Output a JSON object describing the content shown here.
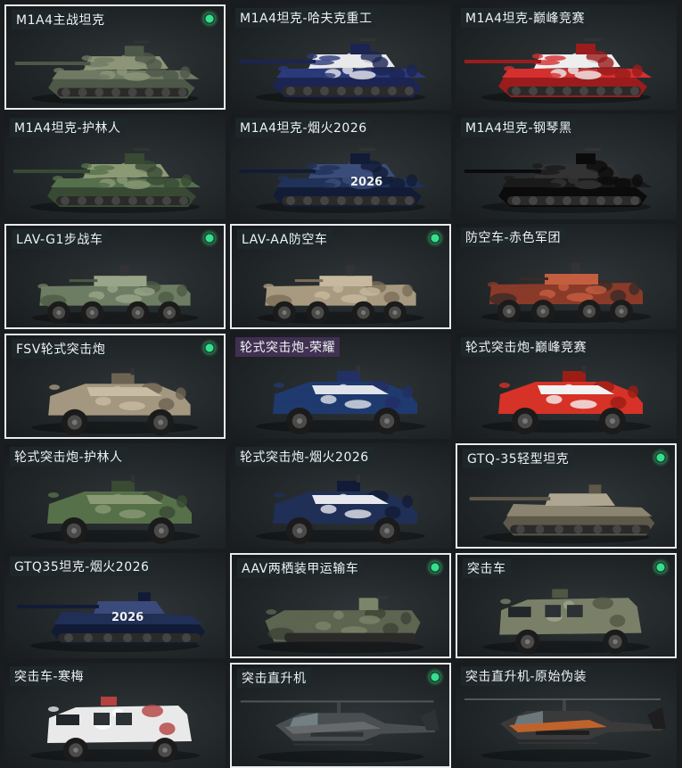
{
  "vehicles": [
    {
      "name": "M1A4主战坦克",
      "owned": true,
      "selected": true,
      "kind": "tank",
      "colors": [
        "#6e7a63",
        "#8d9579",
        "#4d5848"
      ]
    },
    {
      "name": "M1A4坦克-哈夫克重工",
      "owned": false,
      "selected": false,
      "kind": "tank",
      "colors": [
        "#2a3a7a",
        "#e8e8ec",
        "#1c2452"
      ]
    },
    {
      "name": "M1A4坦克-巅峰竞赛",
      "owned": false,
      "selected": false,
      "kind": "tank",
      "colors": [
        "#d43030",
        "#eeeeee",
        "#9a1c1c"
      ]
    },
    {
      "name": "M1A4坦克-护林人",
      "owned": false,
      "selected": false,
      "kind": "tank",
      "colors": [
        "#55704c",
        "#8b9a75",
        "#384a34"
      ]
    },
    {
      "name": "M1A4坦克-烟火2026",
      "owned": false,
      "selected": false,
      "kind": "tank",
      "colors": [
        "#203258",
        "#3b4d7a",
        "#121c36"
      ],
      "badge": "2026"
    },
    {
      "name": "M1A4坦克-钢琴黑",
      "owned": false,
      "selected": false,
      "kind": "tank",
      "colors": [
        "#1a1a1a",
        "#333333",
        "#0b0b0b"
      ]
    },
    {
      "name": "LAV-G1步战车",
      "owned": true,
      "selected": true,
      "kind": "apc",
      "colors": [
        "#6d7d63",
        "#99a588",
        "#4c5a45"
      ]
    },
    {
      "name": "LAV-AA防空车",
      "owned": true,
      "selected": true,
      "kind": "apc",
      "colors": [
        "#a89a80",
        "#c6b99e",
        "#7a6d58"
      ]
    },
    {
      "name": "防空车-赤色军团",
      "owned": false,
      "selected": false,
      "kind": "apc",
      "colors": [
        "#8a3a28",
        "#c45e40",
        "#3a2a26"
      ]
    },
    {
      "name": "FSV轮式突击炮",
      "owned": true,
      "selected": true,
      "kind": "car",
      "colors": [
        "#a4977f",
        "#c8bca4",
        "#6d6352"
      ]
    },
    {
      "name": "轮式突击炮-荣耀",
      "owned": false,
      "selected": false,
      "kind": "car",
      "colors": [
        "#1f3a6e",
        "#dfe3ea",
        "#223066"
      ],
      "label_style": "purple"
    },
    {
      "name": "轮式突击炮-巅峰竞赛",
      "owned": false,
      "selected": false,
      "kind": "car",
      "colors": [
        "#d73227",
        "#f2f2f2",
        "#9b1d16"
      ]
    },
    {
      "name": "轮式突击炮-护林人",
      "owned": false,
      "selected": false,
      "kind": "car",
      "colors": [
        "#56704a",
        "#8a9a74",
        "#3a4a33"
      ]
    },
    {
      "name": "轮式突击炮-烟火2026",
      "owned": false,
      "selected": false,
      "kind": "car",
      "colors": [
        "#1f2f56",
        "#e7e7ee",
        "#121b36"
      ]
    },
    {
      "name": "GTQ-35轻型坦克",
      "owned": true,
      "selected": true,
      "kind": "ltank",
      "colors": [
        "#8b8470",
        "#aea690",
        "#5e584a"
      ]
    },
    {
      "name": "GTQ35坦克-烟火2026",
      "owned": false,
      "selected": false,
      "kind": "ltank",
      "colors": [
        "#1f2f56",
        "#3a4a7a",
        "#121b36"
      ],
      "badge": "2026"
    },
    {
      "name": "AAV两栖装甲运输车",
      "owned": true,
      "selected": true,
      "kind": "aav",
      "colors": [
        "#5d6450",
        "#7c846a",
        "#3e4436"
      ]
    },
    {
      "name": "突击车",
      "owned": true,
      "selected": true,
      "kind": "truck",
      "colors": [
        "#7a8068",
        "#a0a68e",
        "#515644"
      ]
    },
    {
      "name": "突击车-寒梅",
      "owned": false,
      "selected": false,
      "kind": "truck",
      "colors": [
        "#e9e9e9",
        "#ffffff",
        "#b44040"
      ]
    },
    {
      "name": "突击直升机",
      "owned": true,
      "selected": true,
      "kind": "heli",
      "colors": [
        "#4a4e50",
        "#6c7072",
        "#2e3234"
      ]
    },
    {
      "name": "突击直升机-原始伪装",
      "owned": false,
      "selected": false,
      "kind": "heli",
      "colors": [
        "#3a3a3a",
        "#d86a2a",
        "#1e1e1e"
      ]
    }
  ]
}
